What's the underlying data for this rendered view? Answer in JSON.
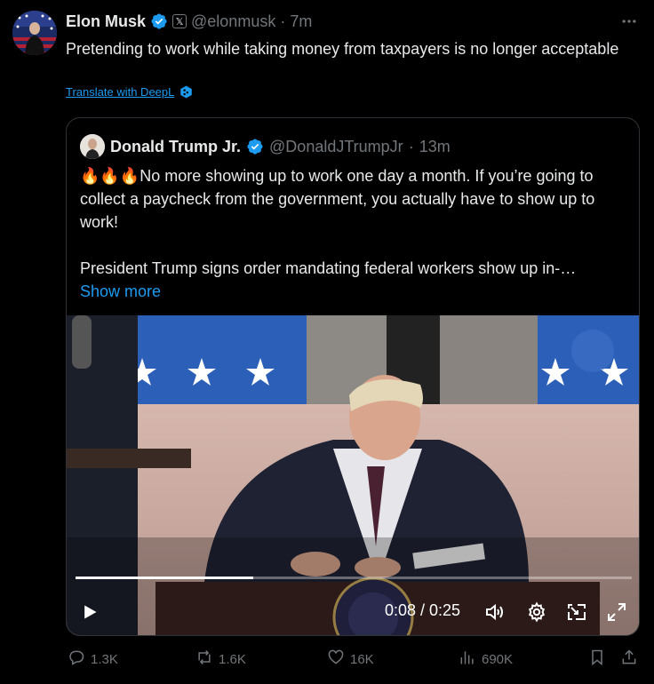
{
  "tweet": {
    "author_name": "Elon Musk",
    "author_handle": "@elonmusk",
    "separator": "·",
    "time": "7m",
    "text": "Pretending to work while taking money from taxpayers is no longer acceptable",
    "translate_label": "Translate with DeepL",
    "more_icon": "more-icon"
  },
  "quote": {
    "author_name": "Donald Trump Jr.",
    "author_handle": "@DonaldJTrumpJr",
    "separator": "·",
    "time": "13m",
    "line1": "🔥🔥🔥No more showing up to work one day a month. If you’re going to collect a paycheck from the government, you actually have to show up to work!",
    "line2": "President Trump signs order mandating federal workers show up in-…",
    "show_more": "Show more"
  },
  "video": {
    "current_time": "0:08",
    "duration": "0:25",
    "time_display": "0:08 / 0:25",
    "progress_fraction": 0.32
  },
  "actions": {
    "replies": "1.3K",
    "reposts": "1.6K",
    "likes": "16K",
    "views": "690K"
  },
  "colors": {
    "background": "#000000",
    "accent": "#1d9bf0",
    "muted": "#71767b",
    "text": "#e7e9ea",
    "border": "#2f3336"
  }
}
